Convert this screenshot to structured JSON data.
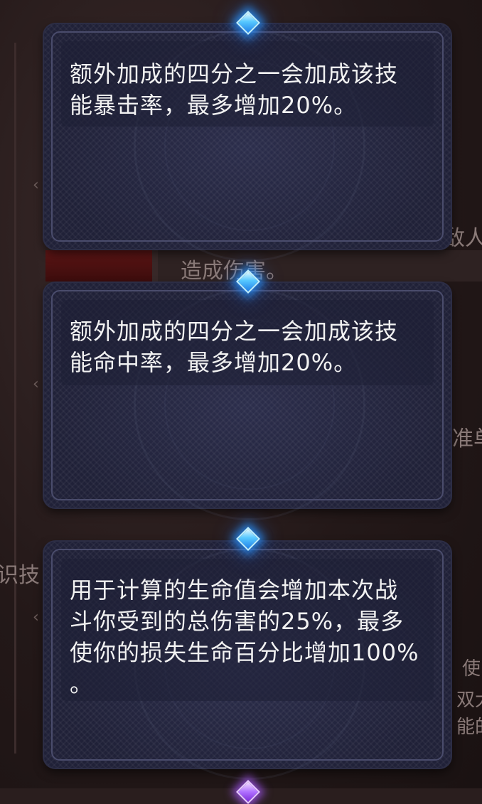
{
  "background": {
    "fragments": [
      "造成伤害。",
      "敌人",
      "准单",
      "识技",
      "使",
      "双大",
      "能的"
    ]
  },
  "tooltips": [
    {
      "gem": "blue-diamond-icon",
      "description": "额外加成的四分之一会加成该技\n能暴击率，最多增加20%。"
    },
    {
      "gem": "blue-diamond-icon",
      "description": "额外加成的四分之一会加成该技\n能命中率，最多增加20%。"
    },
    {
      "gem": "blue-diamond-icon",
      "description": "用于计算的生命值会增加本次战\n斗你受到的总伤害的25%，最多\n使你的损失生命百分比增加100%\n。"
    }
  ],
  "colors": {
    "card_background": "#20213a",
    "card_border": "#4a4c6c",
    "gem_glow": "#2f96ff",
    "text": "#f2f2f2"
  }
}
